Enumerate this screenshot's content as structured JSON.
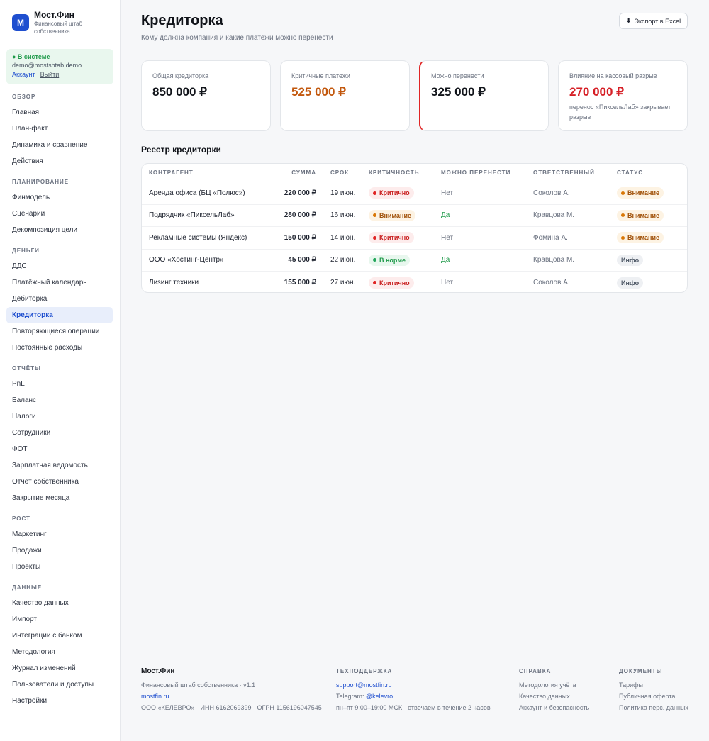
{
  "brand": {
    "logo_letter": "М",
    "name": "Мост.Фин",
    "subtitle": "Финансовый штаб собственника"
  },
  "session": {
    "status": "● В системе",
    "email": "demo@mostshtab.demo",
    "account_link": "Аккаунт",
    "logout_link": "Выйти"
  },
  "nav": [
    {
      "section": "ОБЗОР",
      "items": [
        "Главная",
        "План-факт",
        "Динамика и сравнение",
        "Действия"
      ]
    },
    {
      "section": "ПЛАНИРОВАНИЕ",
      "items": [
        "Финмодель",
        "Сценарии",
        "Декомпозиция цели"
      ]
    },
    {
      "section": "ДЕНЬГИ",
      "items": [
        "ДДС",
        "Платёжный календарь",
        "Дебиторка",
        "Кредиторка",
        "Повторяющиеся операции",
        "Постоянные расходы"
      ]
    },
    {
      "section": "ОТЧЁТЫ",
      "items": [
        "PnL",
        "Баланс",
        "Налоги",
        "Сотрудники",
        "ФОТ",
        "Зарплатная ведомость",
        "Отчёт собственника",
        "Закрытие месяца"
      ]
    },
    {
      "section": "РОСТ",
      "items": [
        "Маркетинг",
        "Продажи",
        "Проекты"
      ]
    },
    {
      "section": "ДАННЫЕ",
      "items": [
        "Качество данных",
        "Импорт",
        "Интеграции с банком",
        "Методология",
        "Журнал изменений",
        "Пользователи и доступы",
        "Настройки"
      ]
    }
  ],
  "active_nav": "Кредиторка",
  "header": {
    "title": "Кредиторка",
    "subtitle": "Кому должна компания и какие платежи можно перенести",
    "export_icon": "download-icon",
    "export_glyph": "⬇",
    "export_label": "Экспорт в Excel"
  },
  "cards": [
    {
      "label": "Общая кредиторка",
      "value": "850 000 ₽",
      "tone": "default",
      "note": ""
    },
    {
      "label": "Критичные платежи",
      "value": "525 000 ₽",
      "tone": "orange",
      "note": ""
    },
    {
      "label": "Можно перенести",
      "value": "325 000 ₽",
      "tone": "default",
      "note": ""
    },
    {
      "label": "Влияние на кассовый разрыв",
      "value": "270 000 ₽",
      "tone": "red",
      "note": "перенос «ПиксельЛаб» закрывает разрыв"
    }
  ],
  "registry": {
    "title": "Реестр кредиторки",
    "columns": [
      "КОНТРАГЕНТ",
      "СУММА",
      "СРОК",
      "КРИТИЧНОСТЬ",
      "МОЖНО ПЕРЕНЕСТИ",
      "ОТВЕТСТВЕННЫЙ",
      "СТАТУС"
    ],
    "rows": [
      {
        "counterparty": "Аренда офиса (БЦ «Полюс»)",
        "amount": "220 000 ₽",
        "due": "19 июн.",
        "criticality": "Критично",
        "crit_tone": "crit",
        "deferrable": "Нет",
        "owner": "Соколов А.",
        "status": "Внимание",
        "status_tone": "warn"
      },
      {
        "counterparty": "Подрядчик «ПиксельЛаб»",
        "amount": "280 000 ₽",
        "due": "16 июн.",
        "criticality": "Внимание",
        "crit_tone": "warn",
        "deferrable": "Да",
        "owner": "Кравцова М.",
        "status": "Внимание",
        "status_tone": "warn"
      },
      {
        "counterparty": "Рекламные системы (Яндекс)",
        "amount": "150 000 ₽",
        "due": "14 июн.",
        "criticality": "Критично",
        "crit_tone": "crit",
        "deferrable": "Нет",
        "owner": "Фомина А.",
        "status": "Внимание",
        "status_tone": "warn"
      },
      {
        "counterparty": "ООО «Хостинг-Центр»",
        "amount": "45 000 ₽",
        "due": "22 июн.",
        "criticality": "В норме",
        "crit_tone": "ok",
        "deferrable": "Да",
        "owner": "Кравцова М.",
        "status": "Инфо",
        "status_tone": "info"
      },
      {
        "counterparty": "Лизинг техники",
        "amount": "155 000 ₽",
        "due": "27 июн.",
        "criticality": "Критично",
        "crit_tone": "crit",
        "deferrable": "Нет",
        "owner": "Соколов А.",
        "status": "Инфо",
        "status_tone": "info"
      }
    ]
  },
  "footer": {
    "brand": {
      "name": "Мост.Фин",
      "line1": "Финансовый штаб собственника · v1.1",
      "link": "mostfin.ru",
      "line3": "ООО «КЕЛЕВРО» · ИНН 6162069399 · ОГРН 1156196047545"
    },
    "support": {
      "title": "ТЕХПОДДЕРЖКА",
      "email": "support@mostfin.ru",
      "telegram_label": "Telegram: ",
      "telegram": "@kelevro",
      "hours": "пн–пт 9:00–19:00 МСК · отвечаем в течение 2 часов"
    },
    "help": {
      "title": "СПРАВКА",
      "links": [
        "Методология учёта",
        "Качество данных",
        "Аккаунт и безопасность"
      ]
    },
    "docs": {
      "title": "ДОКУМЕНТЫ",
      "links": [
        "Тарифы",
        "Публичная оферта",
        "Политика перс. данных"
      ]
    }
  },
  "colors": {
    "accent": "#1f4fcf",
    "critical": "#e02424",
    "warning": "#d97706",
    "ok": "#22a55a"
  }
}
